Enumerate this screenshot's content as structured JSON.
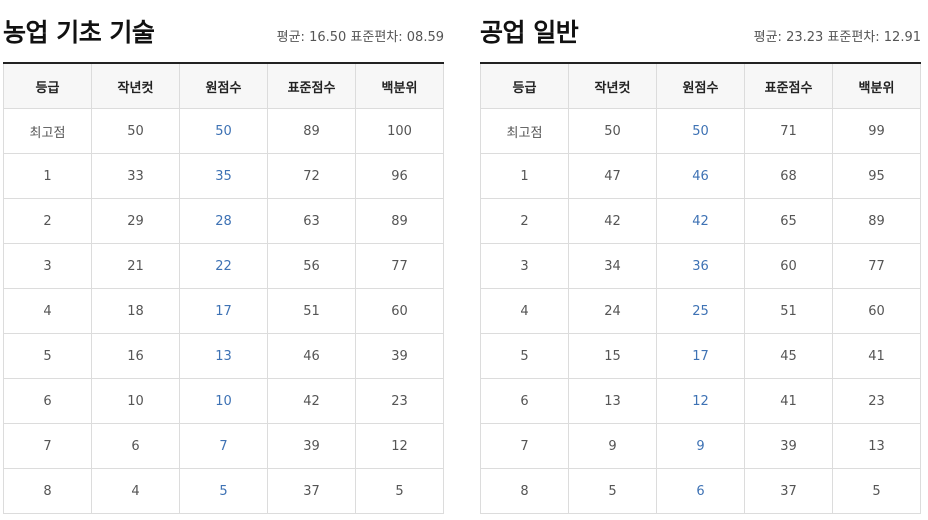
{
  "panels": [
    {
      "title": "농업 기초 기술",
      "stats": "평균: 16.50 표준편차: 08.59",
      "headers": [
        "등급",
        "작년컷",
        "원점수",
        "표준점수",
        "백분위"
      ],
      "rows": [
        [
          "최고점",
          "50",
          "50",
          "89",
          "100"
        ],
        [
          "1",
          "33",
          "35",
          "72",
          "96"
        ],
        [
          "2",
          "29",
          "28",
          "63",
          "89"
        ],
        [
          "3",
          "21",
          "22",
          "56",
          "77"
        ],
        [
          "4",
          "18",
          "17",
          "51",
          "60"
        ],
        [
          "5",
          "16",
          "13",
          "46",
          "39"
        ],
        [
          "6",
          "10",
          "10",
          "42",
          "23"
        ],
        [
          "7",
          "6",
          "7",
          "39",
          "12"
        ],
        [
          "8",
          "4",
          "5",
          "37",
          "5"
        ]
      ]
    },
    {
      "title": "공업 일반",
      "stats": "평균: 23.23 표준편차: 12.91",
      "headers": [
        "등급",
        "작년컷",
        "원점수",
        "표준점수",
        "백분위"
      ],
      "rows": [
        [
          "최고점",
          "50",
          "50",
          "71",
          "99"
        ],
        [
          "1",
          "47",
          "46",
          "68",
          "95"
        ],
        [
          "2",
          "42",
          "42",
          "65",
          "89"
        ],
        [
          "3",
          "34",
          "36",
          "60",
          "77"
        ],
        [
          "4",
          "24",
          "25",
          "51",
          "60"
        ],
        [
          "5",
          "15",
          "17",
          "45",
          "41"
        ],
        [
          "6",
          "13",
          "12",
          "41",
          "23"
        ],
        [
          "7",
          "9",
          "9",
          "39",
          "13"
        ],
        [
          "8",
          "5",
          "6",
          "37",
          "5"
        ]
      ]
    }
  ],
  "colors": {
    "raw_score_accent": "#3e72b4",
    "header_bg": "#f7f7f7",
    "border": "#dcdcdc"
  }
}
